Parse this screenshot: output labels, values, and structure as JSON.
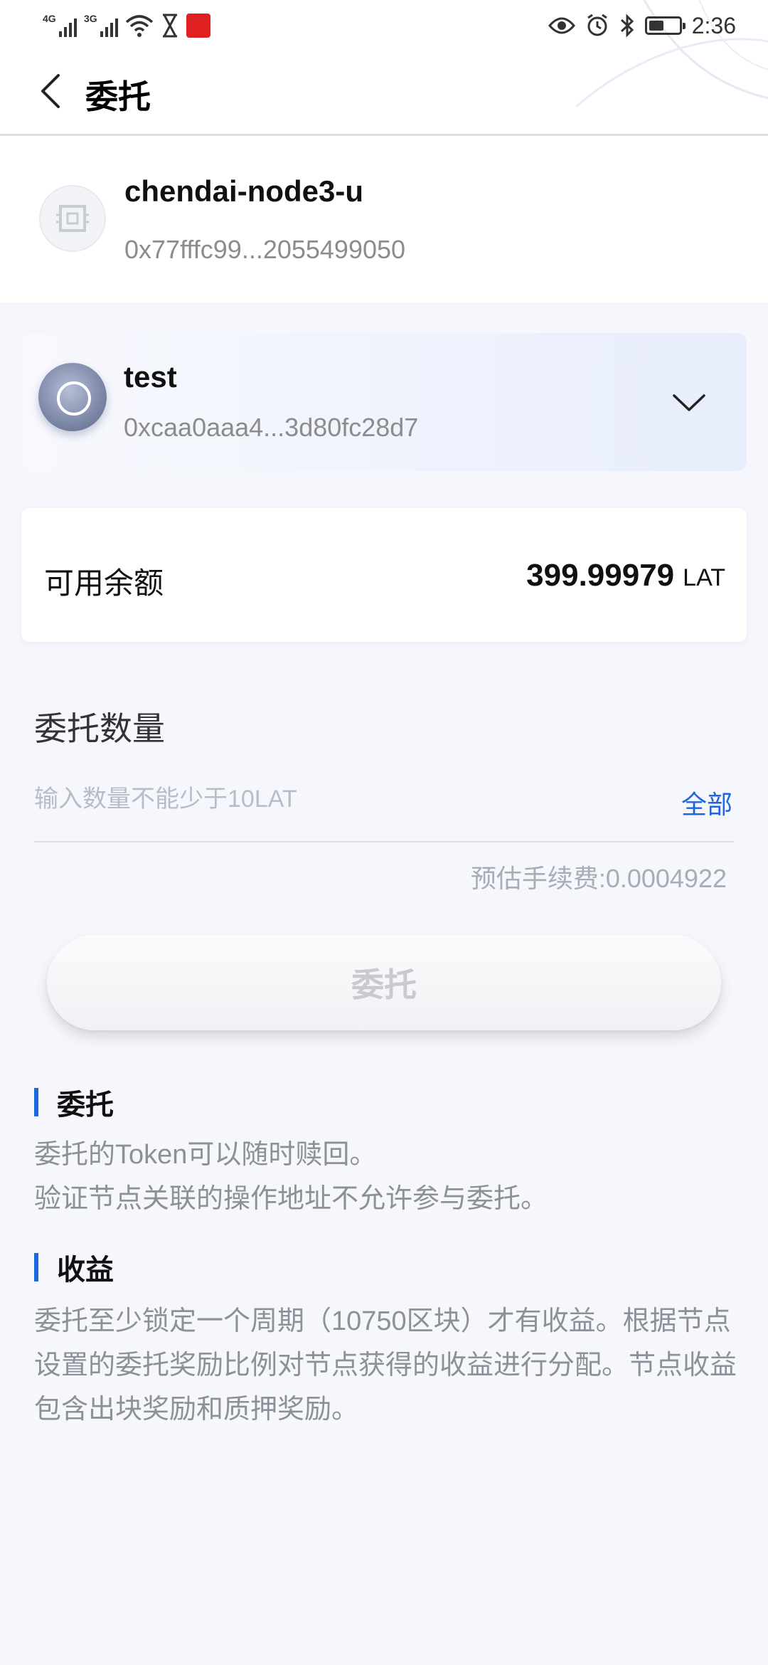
{
  "status_bar": {
    "network_1": "4G",
    "network_2": "3G",
    "time": "2:36",
    "icons": [
      "signal-4g-icon",
      "signal-3g-icon",
      "wifi-icon",
      "hourglass-icon",
      "app-badge-icon",
      "eye-icon",
      "alarm-icon",
      "bluetooth-icon",
      "battery-icon"
    ]
  },
  "nav": {
    "title": "委托",
    "back_icon": "chevron-left-icon"
  },
  "node": {
    "name": "chendai-node3-u",
    "address": "0x77fffc99...2055499050",
    "avatar_icon": "node-avatar-icon"
  },
  "wallet": {
    "name": "test",
    "address": "0xcaa0aaa4...3d80fc28d7",
    "dropdown_icon": "chevron-down-icon"
  },
  "balance": {
    "label": "可用余额",
    "amount": "399.99979",
    "unit": "LAT"
  },
  "amount": {
    "label": "委托数量",
    "value": "",
    "placeholder": "输入数量不能少于10LAT",
    "all_label": "全部",
    "fee_text": "预估手续费:0.0004922"
  },
  "delegate_button": {
    "label": "委托",
    "enabled": false
  },
  "notes": [
    {
      "title": "委托",
      "lines": [
        "委托的Token可以随时赎回。",
        "验证节点关联的操作地址不允许参与委托。"
      ]
    },
    {
      "title": "收益",
      "text": "委托至少锁定一个周期（10750区块）才有收益。根据节点设置的委托奖励比例对节点获得的收益进行分配。节点收益包含出块奖励和质押奖励。"
    }
  ],
  "colors": {
    "accent": "#1e66dd",
    "page_bg": "#f5f7fd",
    "muted_text": "#8d9096",
    "disabled_button_text": "#c8cad0"
  }
}
